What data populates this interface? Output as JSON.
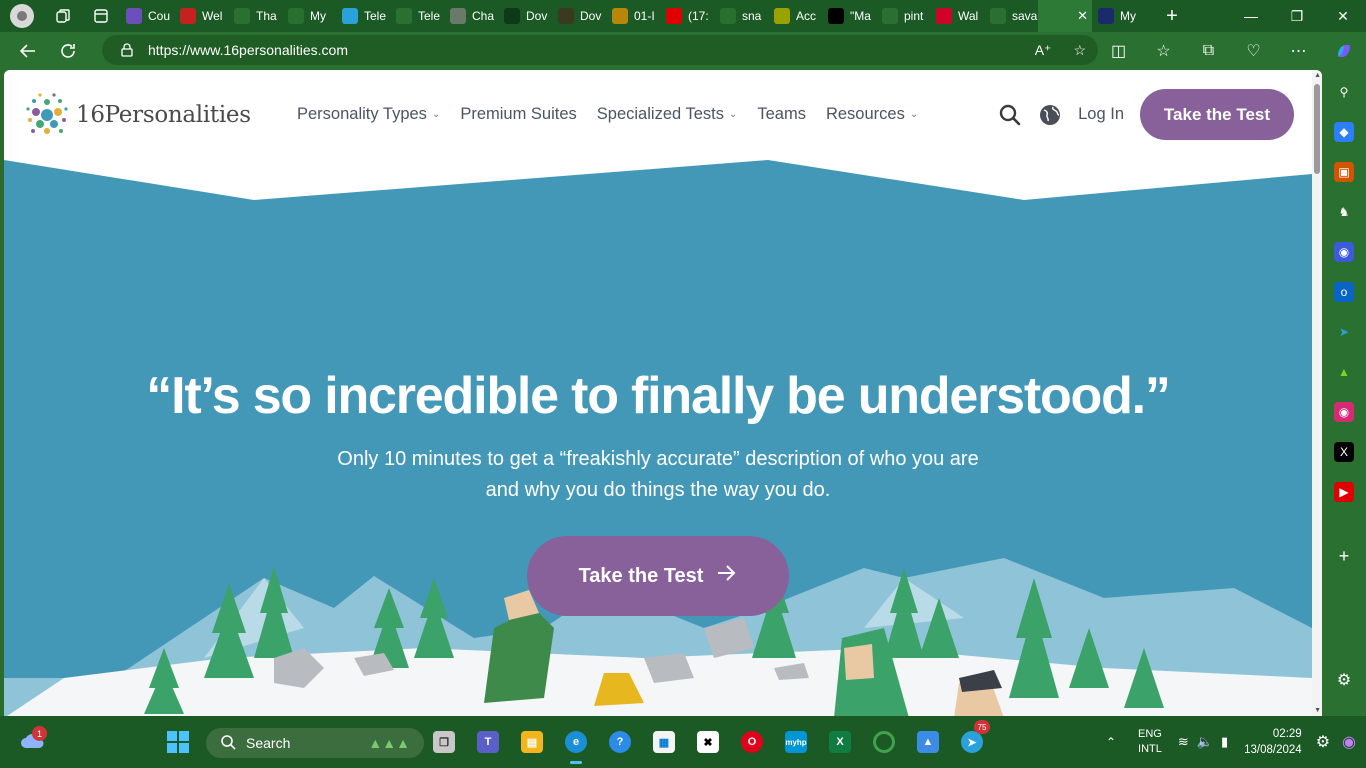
{
  "browser": {
    "tabs": [
      {
        "label": "Cou",
        "icon": "shield-icon",
        "color": "#6b4fbb"
      },
      {
        "label": "Wel",
        "icon": "gmail-icon",
        "color": "#c5221f"
      },
      {
        "label": "Tha",
        "icon": "page-icon",
        "color": "#2a7030"
      },
      {
        "label": "My",
        "icon": "",
        "color": "#2a7030"
      },
      {
        "label": "Tele",
        "icon": "telegram-icon",
        "color": "#2aa1da"
      },
      {
        "label": "Tele",
        "icon": "page-icon",
        "color": "#2a7030"
      },
      {
        "label": "Cha",
        "icon": "chatgpt-icon",
        "color": "#6a7a6a"
      },
      {
        "label": "Dov",
        "icon": "spinner-icon",
        "color": "#0e3a18"
      },
      {
        "label": "Dov",
        "icon": "spinner-icon",
        "color": "#3a3a20"
      },
      {
        "label": "01-I",
        "icon": "book-icon",
        "color": "#b8860b"
      },
      {
        "label": "(17:",
        "icon": "youtube-icon",
        "color": "#e00000"
      },
      {
        "label": "sna",
        "icon": "search-icon",
        "color": "#2a7030"
      },
      {
        "label": "Acc",
        "icon": "snapchat-icon",
        "color": "#9aa200"
      },
      {
        "label": "\"Ma",
        "icon": "x-icon",
        "color": "#000000"
      },
      {
        "label": "pint",
        "icon": "search-icon",
        "color": "#2a7030"
      },
      {
        "label": "Wal",
        "icon": "pinterest-icon",
        "color": "#d0022a"
      },
      {
        "label": "sava",
        "icon": "search-icon",
        "color": "#2a7030"
      },
      {
        "label": "",
        "icon": "16p-icon",
        "color": "#2c7a35",
        "active": true
      },
      {
        "label": "My",
        "icon": "",
        "color": "#1a2a6a"
      }
    ],
    "url": "https://www.16personalities.com"
  },
  "site": {
    "logo_text": "16Personalities",
    "nav": [
      {
        "label": "Personality Types",
        "dropdown": true
      },
      {
        "label": "Premium Suites",
        "dropdown": false
      },
      {
        "label": "Specialized Tests",
        "dropdown": true
      },
      {
        "label": "Teams",
        "dropdown": false
      },
      {
        "label": "Resources",
        "dropdown": true
      }
    ],
    "login": "Log In",
    "cta_header": "Take the Test"
  },
  "hero": {
    "headline": "“It’s so incredible to finally be understood.”",
    "subtitle": "Only 10 minutes to get a “freakishly accurate” description of who you are and why you do things the way you do.",
    "cta": "Take the Test",
    "bg_color": "#4398b8",
    "accent_color": "#88619a"
  },
  "taskbar": {
    "search_placeholder": "Search",
    "weather_badge": "1",
    "telegram_badge": "75",
    "lang_top": "ENG",
    "lang_bottom": "INTL",
    "time": "02:29",
    "date": "13/08/2024"
  }
}
